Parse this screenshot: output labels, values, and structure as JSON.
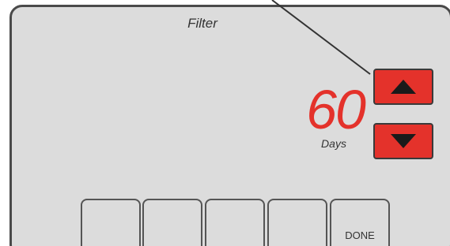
{
  "screen": {
    "title": "Filter",
    "value": "60",
    "unit": "Days"
  },
  "controls": {
    "up_icon": "arrow-up-icon",
    "down_icon": "arrow-down-icon"
  },
  "soft_keys": {
    "key1_label": "",
    "key2_label": "",
    "key3_label": "",
    "key4_label": "",
    "done_label": "DONE"
  },
  "colors": {
    "display_background": "#dcdcdc",
    "accent_red": "#e4322b",
    "border": "#4a4a4a"
  }
}
